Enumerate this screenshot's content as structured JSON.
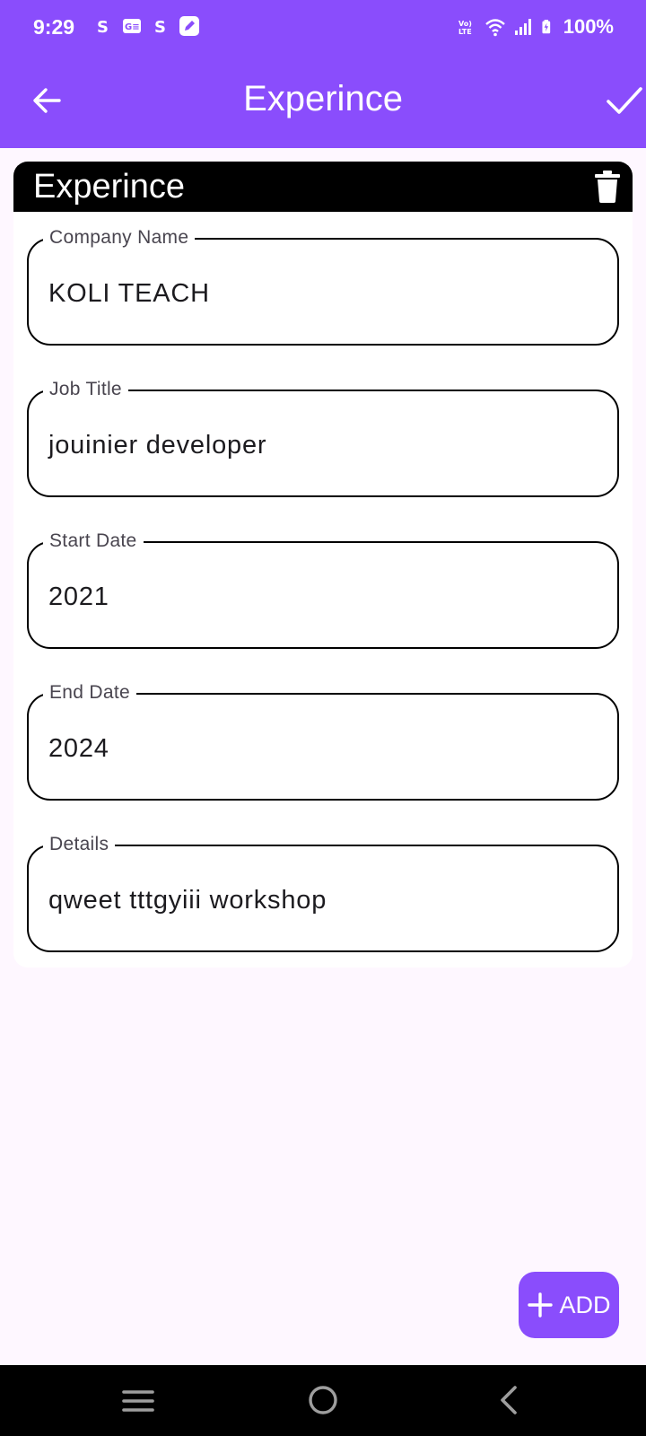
{
  "status_bar": {
    "time": "9:29",
    "battery_text": "100%",
    "left_icons": [
      "notification-s-icon",
      "notification-card-icon",
      "notification-s-icon",
      "notification-edit-icon"
    ],
    "right_icons": [
      "volte-icon",
      "wifi-icon",
      "signal-icon",
      "battery-charging-icon"
    ]
  },
  "app_bar": {
    "title": "Experince",
    "leading_icon": "arrow-back-icon",
    "action_icon": "check-icon",
    "background_color": "#8a4dfc"
  },
  "card": {
    "header_title": "Experince",
    "delete_icon": "trash-icon",
    "fields": [
      {
        "label": "Company Name",
        "value": "KOLI TEACH"
      },
      {
        "label": "Job Title",
        "value": "jouinier developer"
      },
      {
        "label": "Start Date",
        "value": "2021"
      },
      {
        "label": "End Date",
        "value": "2024"
      },
      {
        "label": "Details",
        "value": "qweet tttgyiii workshop"
      }
    ]
  },
  "fab": {
    "label": "ADD",
    "icon": "plus-icon"
  },
  "nav_bar": {
    "icons": [
      "recent-apps-icon",
      "home-icon",
      "back-icon"
    ]
  }
}
